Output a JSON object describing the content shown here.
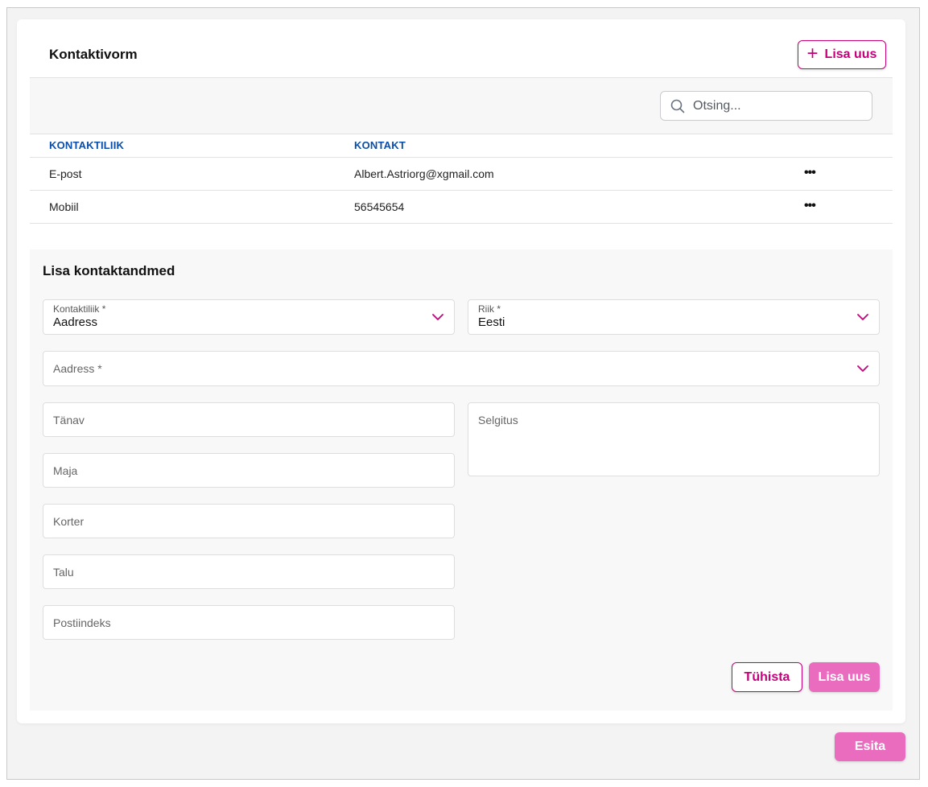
{
  "header": {
    "title": "Kontaktivorm",
    "add_button_label": "Lisa uus"
  },
  "search": {
    "placeholder": "Otsing..."
  },
  "table": {
    "columns": [
      "KONTAKTILIIK",
      "KONTAKT"
    ],
    "rows": [
      {
        "type": "E-post",
        "contact": "Albert.Astriorg@xgmail.com",
        "actions": "•••"
      },
      {
        "type": "Mobiil",
        "contact": "56545654",
        "actions": "•••"
      }
    ]
  },
  "form": {
    "title": "Lisa kontaktandmed",
    "contact_type": {
      "label": "Kontaktiliik *",
      "value": "Aadress"
    },
    "country": {
      "label": "Riik *",
      "value": "Eesti"
    },
    "address": {
      "placeholder": "Aadress *"
    },
    "street": {
      "placeholder": "Tänav"
    },
    "house": {
      "placeholder": "Maja"
    },
    "apartment": {
      "placeholder": "Korter"
    },
    "farm": {
      "placeholder": "Talu"
    },
    "postal_code": {
      "placeholder": "Postiindeks"
    },
    "explanation": {
      "placeholder": "Selgitus"
    },
    "cancel_label": "Tühista",
    "add_label": "Lisa uus"
  },
  "footer": {
    "submit_label": "Esita"
  },
  "colors": {
    "accent": "#c5007a",
    "button_fill": "#e96cbf",
    "header_text": "#0b4ea8"
  },
  "icons": [
    "plus-icon",
    "search-icon",
    "chevron-down-icon",
    "more-options-icon"
  ]
}
